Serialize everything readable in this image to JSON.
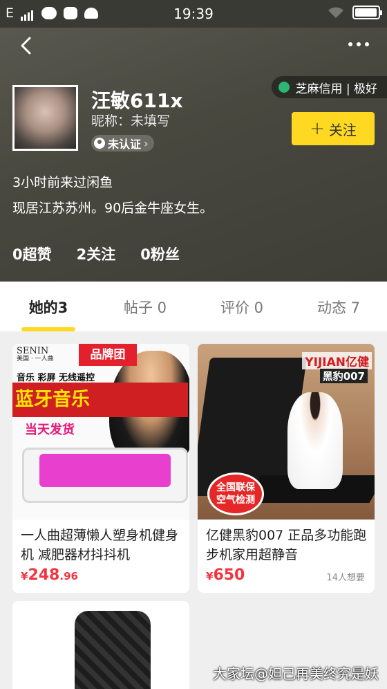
{
  "statusbar": {
    "carrier": "E",
    "time": "19:39",
    "battery_level": 0.9
  },
  "header": {
    "sesame_label": "芝麻信用 | 极好",
    "user_name": "汪敏611x",
    "nickname": "昵称：未填写",
    "verify_label": "未认证",
    "follow_label": "关注",
    "last_seen": "3小时前来过闲鱼",
    "bio": "现居江苏苏州。90后金牛座女生。",
    "stats": [
      {
        "label": "0超赞"
      },
      {
        "label": "2关注"
      },
      {
        "label": "0粉丝"
      }
    ]
  },
  "tabs": [
    {
      "label": "她的3",
      "active": true
    },
    {
      "label": "帖子 0",
      "active": false
    },
    {
      "label": "评价 0",
      "active": false
    },
    {
      "label": "动态 7",
      "active": false
    }
  ],
  "listings": [
    {
      "title": "一人曲超薄懒人塑身机健身机 减肥器材抖抖机",
      "price_symbol": "¥",
      "price_int": "248",
      "price_dec": ".96",
      "wants": "",
      "image": {
        "brand": "SENIN",
        "brand_sub": "美国 · 一人曲",
        "tag": "品牌团",
        "features": "音乐 彩屏 无线遥控",
        "banner": "蓝牙音乐",
        "shipping": "当天发货"
      }
    },
    {
      "title": "亿健黑豹007 正品多功能跑步机家用超静音",
      "price_symbol": "¥",
      "price_int": "650",
      "price_dec": "",
      "wants": "14人想要",
      "image": {
        "brand": "YIJIAN亿健",
        "model": "黑豹007",
        "badge_line1": "全国联保",
        "badge_line2": "空气检测"
      }
    }
  ],
  "watermark": "大家坛@妲己再美终究是妖",
  "colors": {
    "accent": "#ffd921",
    "price": "#f4343f",
    "sesame": "#2bb673"
  }
}
